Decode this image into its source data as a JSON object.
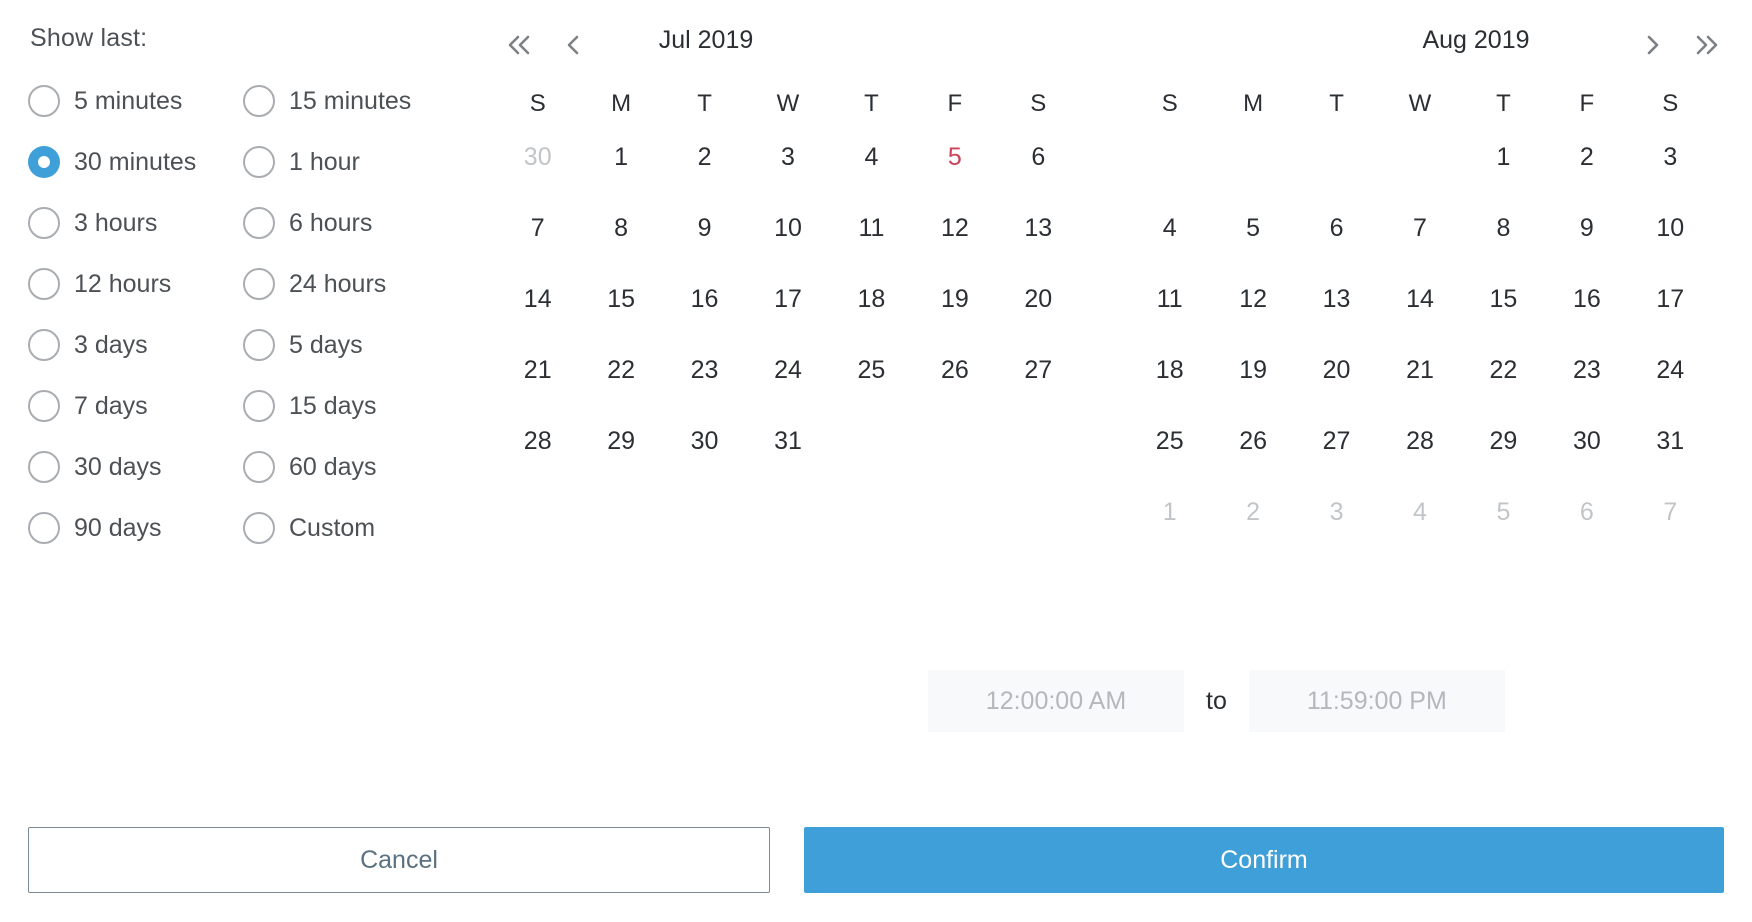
{
  "left_panel": {
    "heading": "Show last:",
    "selected_value": "30 minutes",
    "options": [
      {
        "label": "5 minutes",
        "selected": false
      },
      {
        "label": "15 minutes",
        "selected": false
      },
      {
        "label": "30 minutes",
        "selected": true
      },
      {
        "label": "1 hour",
        "selected": false
      },
      {
        "label": "3 hours",
        "selected": false
      },
      {
        "label": "6 hours",
        "selected": false
      },
      {
        "label": "12 hours",
        "selected": false
      },
      {
        "label": "24 hours",
        "selected": false
      },
      {
        "label": "3 days",
        "selected": false
      },
      {
        "label": "5 days",
        "selected": false
      },
      {
        "label": "7 days",
        "selected": false
      },
      {
        "label": "15 days",
        "selected": false
      },
      {
        "label": "30 days",
        "selected": false
      },
      {
        "label": "60 days",
        "selected": false
      },
      {
        "label": "90 days",
        "selected": false
      },
      {
        "label": "Custom",
        "selected": false
      }
    ]
  },
  "calendar": {
    "nav": {
      "prev_year_icon": "double-chevron-left-icon",
      "prev_month_icon": "chevron-left-icon",
      "next_month_icon": "chevron-right-icon",
      "next_year_icon": "double-chevron-right-icon"
    },
    "weekday_headers": [
      "S",
      "M",
      "T",
      "W",
      "T",
      "F",
      "S"
    ],
    "months": [
      {
        "title": "Jul 2019",
        "weeks": [
          [
            {
              "day": "30",
              "state": "muted"
            },
            {
              "day": "1",
              "state": "normal"
            },
            {
              "day": "2",
              "state": "normal"
            },
            {
              "day": "3",
              "state": "normal"
            },
            {
              "day": "4",
              "state": "normal"
            },
            {
              "day": "5",
              "state": "today"
            },
            {
              "day": "6",
              "state": "normal"
            }
          ],
          [
            {
              "day": "7",
              "state": "normal"
            },
            {
              "day": "8",
              "state": "normal"
            },
            {
              "day": "9",
              "state": "normal"
            },
            {
              "day": "10",
              "state": "normal"
            },
            {
              "day": "11",
              "state": "normal"
            },
            {
              "day": "12",
              "state": "normal"
            },
            {
              "day": "13",
              "state": "normal"
            }
          ],
          [
            {
              "day": "14",
              "state": "normal"
            },
            {
              "day": "15",
              "state": "normal"
            },
            {
              "day": "16",
              "state": "normal"
            },
            {
              "day": "17",
              "state": "normal"
            },
            {
              "day": "18",
              "state": "normal"
            },
            {
              "day": "19",
              "state": "normal"
            },
            {
              "day": "20",
              "state": "normal"
            }
          ],
          [
            {
              "day": "21",
              "state": "normal"
            },
            {
              "day": "22",
              "state": "normal"
            },
            {
              "day": "23",
              "state": "normal"
            },
            {
              "day": "24",
              "state": "normal"
            },
            {
              "day": "25",
              "state": "normal"
            },
            {
              "day": "26",
              "state": "normal"
            },
            {
              "day": "27",
              "state": "normal"
            }
          ],
          [
            {
              "day": "28",
              "state": "normal"
            },
            {
              "day": "29",
              "state": "normal"
            },
            {
              "day": "30",
              "state": "normal"
            },
            {
              "day": "31",
              "state": "normal"
            },
            {
              "day": "",
              "state": "empty"
            },
            {
              "day": "",
              "state": "empty"
            },
            {
              "day": "",
              "state": "empty"
            }
          ],
          [
            {
              "day": "",
              "state": "empty"
            },
            {
              "day": "",
              "state": "empty"
            },
            {
              "day": "",
              "state": "empty"
            },
            {
              "day": "",
              "state": "empty"
            },
            {
              "day": "",
              "state": "empty"
            },
            {
              "day": "",
              "state": "empty"
            },
            {
              "day": "",
              "state": "empty"
            }
          ]
        ]
      },
      {
        "title": "Aug 2019",
        "weeks": [
          [
            {
              "day": "",
              "state": "empty"
            },
            {
              "day": "",
              "state": "empty"
            },
            {
              "day": "",
              "state": "empty"
            },
            {
              "day": "",
              "state": "empty"
            },
            {
              "day": "1",
              "state": "normal"
            },
            {
              "day": "2",
              "state": "normal"
            },
            {
              "day": "3",
              "state": "normal"
            }
          ],
          [
            {
              "day": "4",
              "state": "normal"
            },
            {
              "day": "5",
              "state": "normal"
            },
            {
              "day": "6",
              "state": "normal"
            },
            {
              "day": "7",
              "state": "normal"
            },
            {
              "day": "8",
              "state": "normal"
            },
            {
              "day": "9",
              "state": "normal"
            },
            {
              "day": "10",
              "state": "normal"
            }
          ],
          [
            {
              "day": "11",
              "state": "normal"
            },
            {
              "day": "12",
              "state": "normal"
            },
            {
              "day": "13",
              "state": "normal"
            },
            {
              "day": "14",
              "state": "normal"
            },
            {
              "day": "15",
              "state": "normal"
            },
            {
              "day": "16",
              "state": "normal"
            },
            {
              "day": "17",
              "state": "normal"
            }
          ],
          [
            {
              "day": "18",
              "state": "normal"
            },
            {
              "day": "19",
              "state": "normal"
            },
            {
              "day": "20",
              "state": "normal"
            },
            {
              "day": "21",
              "state": "normal"
            },
            {
              "day": "22",
              "state": "normal"
            },
            {
              "day": "23",
              "state": "normal"
            },
            {
              "day": "24",
              "state": "normal"
            }
          ],
          [
            {
              "day": "25",
              "state": "normal"
            },
            {
              "day": "26",
              "state": "normal"
            },
            {
              "day": "27",
              "state": "normal"
            },
            {
              "day": "28",
              "state": "normal"
            },
            {
              "day": "29",
              "state": "normal"
            },
            {
              "day": "30",
              "state": "normal"
            },
            {
              "day": "31",
              "state": "normal"
            }
          ],
          [
            {
              "day": "1",
              "state": "muted"
            },
            {
              "day": "2",
              "state": "muted"
            },
            {
              "day": "3",
              "state": "muted"
            },
            {
              "day": "4",
              "state": "muted"
            },
            {
              "day": "5",
              "state": "muted"
            },
            {
              "day": "6",
              "state": "muted"
            },
            {
              "day": "7",
              "state": "muted"
            }
          ]
        ]
      }
    ]
  },
  "time_range": {
    "start_value": "12:00:00 AM",
    "separator": "to",
    "end_value": "11:59:00 PM"
  },
  "footer": {
    "cancel_label": "Cancel",
    "confirm_label": "Confirm"
  },
  "colors": {
    "accent_blue": "#3f9fd8",
    "today_red": "#cb4257",
    "muted_gray": "#c2c5c8",
    "text": "#2b2f33",
    "cancel_border": "#7a8b97",
    "cancel_text": "#5b7180",
    "time_field_bg": "#f7f9fa"
  }
}
